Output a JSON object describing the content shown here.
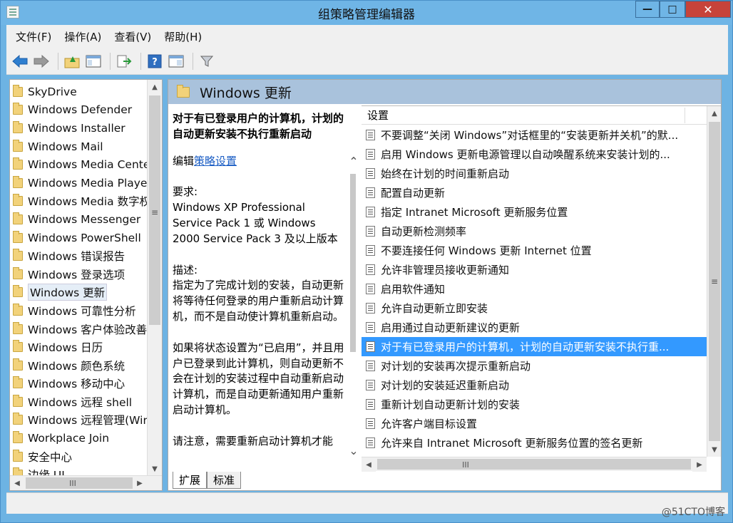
{
  "window": {
    "title": "组策略管理编辑器",
    "controls": {
      "minimize": "—",
      "maximize": "□",
      "close": "✕"
    }
  },
  "menubar": {
    "items": [
      "文件(F)",
      "操作(A)",
      "查看(V)",
      "帮助(H)"
    ]
  },
  "toolbar": {
    "buttons": [
      "back-icon",
      "forward-icon",
      "folder-up-icon",
      "show-hide-tree-icon",
      "export-icon",
      "help-icon",
      "properties-icon",
      "filter-icon"
    ]
  },
  "tree": {
    "items": [
      "SkyDrive",
      "Windows Defender",
      "Windows Installer",
      "Windows Mail",
      "Windows Media Cente",
      "Windows Media Playe",
      "Windows Media 数字权",
      "Windows Messenger",
      "Windows PowerShell",
      "Windows 错误报告",
      "Windows 登录选项",
      "Windows 更新",
      "Windows 可靠性分析",
      "Windows 客户体验改善",
      "Windows 日历",
      "Windows 颜色系统",
      "Windows 移动中心",
      "Windows 远程 shell",
      "Windows 远程管理(Win",
      "Workplace Join",
      "安全中心",
      "边缘 UI"
    ],
    "selected_index": 11,
    "hscroll_label": "III",
    "vscroll_label": "≡"
  },
  "right": {
    "header_title": "Windows 更新",
    "description": {
      "policy_title": "对于有已登录用户的计算机，计划的自动更新安装不执行重新启动",
      "edit_prefix": "编辑",
      "edit_link": "策略设置",
      "requirements_label": "要求:",
      "requirements_text": "Windows XP Professional Service Pack 1 或 Windows 2000 Service Pack 3 及以上版本",
      "description_label": "描述:",
      "description_text": "指定为了完成计划的安装，自动更新将等待任何登录的用户重新启动计算机，而不是自动使计算机重新启动。",
      "para2": "如果将状态设置为“已启用”，并且用户已登录到此计算机，则自动更新不会在计划的安装过程中自动重新启动计算机，而是自动更新通知用户重新启动计算机。",
      "para3": "请注意，需要重新启动计算机才能"
    },
    "settings": {
      "column_header": "设置",
      "rows": [
        "不要调整“关闭 Windows”对话框里的“安装更新并关机”的默...",
        "启用 Windows 更新电源管理以自动唤醒系统来安装计划的...",
        "始终在计划的时间重新启动",
        "配置自动更新",
        "指定 Intranet Microsoft 更新服务位置",
        "自动更新检测频率",
        "不要连接任何 Windows 更新 Internet 位置",
        "允许非管理员接收更新通知",
        "启用软件通知",
        "允许自动更新立即安装",
        "启用通过自动更新建议的更新",
        "对于有已登录用户的计算机，计划的自动更新安装不执行重...",
        "对计划的安装再次提示重新启动",
        "对计划的安装延迟重新启动",
        "重新计划自动更新计划的安装",
        "允许客户端目标设置",
        "允许来自 Intranet Microsoft 更新服务位置的签名更新"
      ],
      "selected_index": 11,
      "hscroll_label": "III",
      "vscroll_label": "≡"
    },
    "tabs": [
      "扩展",
      "标准"
    ]
  },
  "watermark": "@51CTO博客",
  "colors": {
    "titlebar": "#6fb5e6",
    "close_button": "#c7433a",
    "selection": "#3399ff",
    "header_band": "#a9c2dc",
    "link": "#1a5dc4"
  }
}
